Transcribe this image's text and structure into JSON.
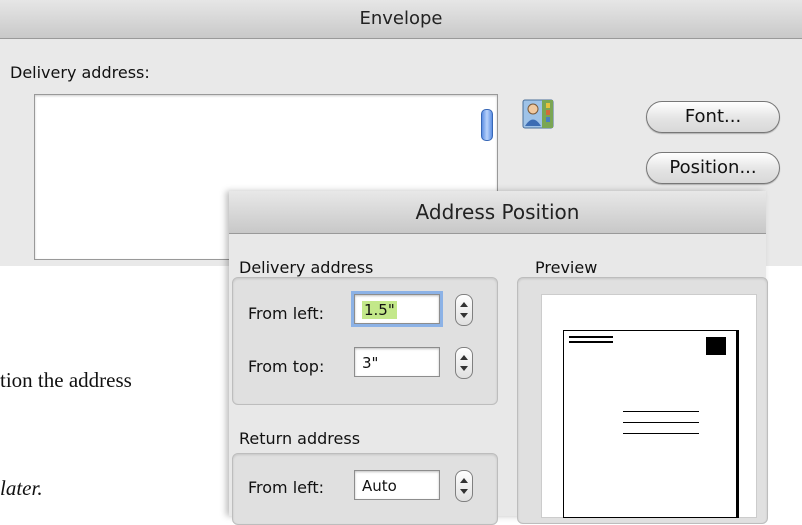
{
  "envelope_dialog": {
    "title": "Envelope",
    "delivery_address_label": "Delivery address:",
    "delivery_address_value": "",
    "font_button": "Font...",
    "position_button": "Position..."
  },
  "page_text": {
    "line1": "tion the address",
    "line2": "later."
  },
  "address_position_dialog": {
    "title": "Address Position",
    "delivery_address_group": "Delivery address",
    "from_left_label": "From left:",
    "from_left_value": "1.5\"",
    "from_top_label": "From top:",
    "from_top_value": "3\"",
    "return_address_group": "Return address",
    "return_from_left_label": "From left:",
    "return_from_left_value": "Auto",
    "preview_label": "Preview"
  },
  "colors": {
    "selection_highlight": "#c3e88a",
    "focus_ring": "#8cb2e6",
    "scroll_thumb": "#5d8fe3"
  }
}
